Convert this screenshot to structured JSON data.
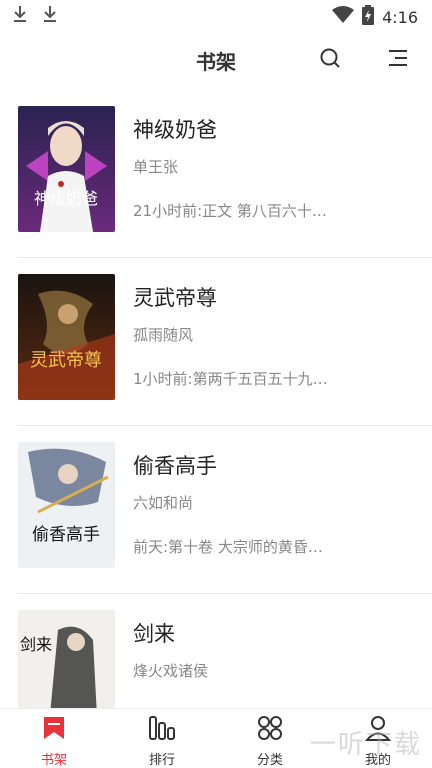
{
  "status_bar": {
    "time": "4:16"
  },
  "header": {
    "title": "书架"
  },
  "books": [
    {
      "title": "神级奶爸",
      "author": "单王张",
      "update": "21小时前:正文 第八百六十…",
      "cover_text": "神级奶爸"
    },
    {
      "title": "灵武帝尊",
      "author": "孤雨随风",
      "update": "1小时前:第两千五百五十九…",
      "cover_text": "灵武帝尊"
    },
    {
      "title": "偷香高手",
      "author": "六如和尚",
      "update": "前天:第十卷 大宗师的黄昏…",
      "cover_text": "偷香高手"
    },
    {
      "title": "剑来",
      "author": "烽火戏诸侯",
      "update": "",
      "cover_text": "剑来"
    }
  ],
  "tabs": [
    {
      "label": "书架",
      "icon": "bookmark-icon",
      "active": true
    },
    {
      "label": "排行",
      "icon": "ranking-icon",
      "active": false
    },
    {
      "label": "分类",
      "icon": "category-icon",
      "active": false
    },
    {
      "label": "我的",
      "icon": "profile-icon",
      "active": false
    }
  ],
  "watermark": "一听下载",
  "colors": {
    "accent": "#e8323c",
    "text": "#222222",
    "muted": "#888888"
  }
}
